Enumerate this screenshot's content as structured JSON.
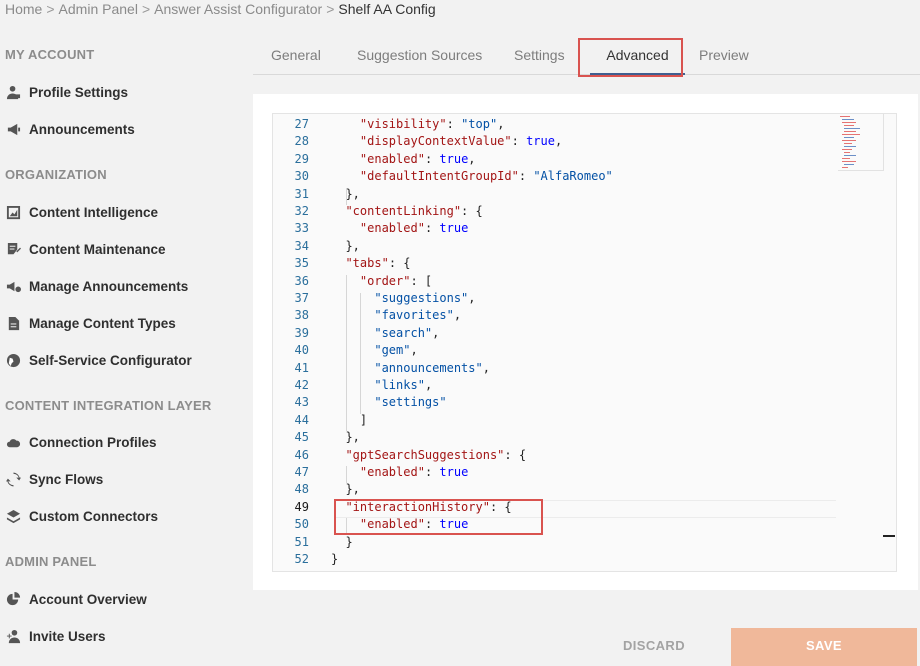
{
  "breadcrumb": {
    "items": [
      "Home",
      "Admin Panel",
      "Answer Assist Configurator"
    ],
    "current": "Shelf AA Config",
    "separator": ">"
  },
  "sidebar": {
    "my_account": {
      "title": "MY ACCOUNT",
      "items": [
        {
          "label": "Profile Settings",
          "icon": "profile-settings-icon"
        },
        {
          "label": "Announcements",
          "icon": "megaphone-icon"
        }
      ]
    },
    "organization": {
      "title": "ORGANIZATION",
      "items": [
        {
          "label": "Content Intelligence",
          "icon": "image-chart-icon"
        },
        {
          "label": "Content Maintenance",
          "icon": "document-edit-icon"
        },
        {
          "label": "Manage Announcements",
          "icon": "megaphone-gear-icon"
        },
        {
          "label": "Manage Content Types",
          "icon": "file-icon"
        },
        {
          "label": "Self-Service Configurator",
          "icon": "globe-icon"
        }
      ]
    },
    "integration": {
      "title": "CONTENT INTEGRATION LAYER",
      "items": [
        {
          "label": "Connection Profiles",
          "icon": "cloud-icon"
        },
        {
          "label": "Sync Flows",
          "icon": "sync-icon"
        },
        {
          "label": "Custom Connectors",
          "icon": "layers-icon"
        }
      ]
    },
    "admin_panel": {
      "title": "ADMIN PANEL",
      "items": [
        {
          "label": "Account Overview",
          "icon": "pie-chart-icon"
        },
        {
          "label": "Invite Users",
          "icon": "add-user-icon"
        }
      ]
    }
  },
  "tabs": [
    "General",
    "Suggestion Sources",
    "Settings",
    "Advanced",
    "Preview"
  ],
  "active_tab": "Advanced",
  "editor": {
    "lines": [
      {
        "n": "27",
        "t": [
          [
            "    ",
            "p"
          ],
          [
            "\"visibility\"",
            "k"
          ],
          [
            ": ",
            "p"
          ],
          [
            "\"top\"",
            "s"
          ],
          [
            ",",
            "p"
          ]
        ]
      },
      {
        "n": "28",
        "t": [
          [
            "    ",
            "p"
          ],
          [
            "\"displayContextValue\"",
            "k"
          ],
          [
            ": ",
            "p"
          ],
          [
            "true",
            "b"
          ],
          [
            ",",
            "p"
          ]
        ]
      },
      {
        "n": "29",
        "t": [
          [
            "    ",
            "p"
          ],
          [
            "\"enabled\"",
            "k"
          ],
          [
            ": ",
            "p"
          ],
          [
            "true",
            "b"
          ],
          [
            ",",
            "p"
          ]
        ]
      },
      {
        "n": "30",
        "t": [
          [
            "    ",
            "p"
          ],
          [
            "\"defaultIntentGroupId\"",
            "k"
          ],
          [
            ": ",
            "p"
          ],
          [
            "\"AlfaRomeo\"",
            "s"
          ]
        ]
      },
      {
        "n": "31",
        "t": [
          [
            "  },",
            "p"
          ]
        ]
      },
      {
        "n": "32",
        "t": [
          [
            "  ",
            "p"
          ],
          [
            "\"contentLinking\"",
            "k"
          ],
          [
            ": {",
            "p"
          ]
        ]
      },
      {
        "n": "33",
        "t": [
          [
            "    ",
            "p"
          ],
          [
            "\"enabled\"",
            "k"
          ],
          [
            ": ",
            "p"
          ],
          [
            "true",
            "b"
          ]
        ]
      },
      {
        "n": "34",
        "t": [
          [
            "  },",
            "p"
          ]
        ]
      },
      {
        "n": "35",
        "t": [
          [
            "  ",
            "p"
          ],
          [
            "\"tabs\"",
            "k"
          ],
          [
            ": {",
            "p"
          ]
        ]
      },
      {
        "n": "36",
        "t": [
          [
            "    ",
            "p"
          ],
          [
            "\"order\"",
            "k"
          ],
          [
            ": [",
            "p"
          ]
        ]
      },
      {
        "n": "37",
        "t": [
          [
            "      ",
            "p"
          ],
          [
            "\"suggestions\"",
            "s"
          ],
          [
            ",",
            "p"
          ]
        ]
      },
      {
        "n": "38",
        "t": [
          [
            "      ",
            "p"
          ],
          [
            "\"favorites\"",
            "s"
          ],
          [
            ",",
            "p"
          ]
        ]
      },
      {
        "n": "39",
        "t": [
          [
            "      ",
            "p"
          ],
          [
            "\"search\"",
            "s"
          ],
          [
            ",",
            "p"
          ]
        ]
      },
      {
        "n": "40",
        "t": [
          [
            "      ",
            "p"
          ],
          [
            "\"gem\"",
            "s"
          ],
          [
            ",",
            "p"
          ]
        ]
      },
      {
        "n": "41",
        "t": [
          [
            "      ",
            "p"
          ],
          [
            "\"announcements\"",
            "s"
          ],
          [
            ",",
            "p"
          ]
        ]
      },
      {
        "n": "42",
        "t": [
          [
            "      ",
            "p"
          ],
          [
            "\"links\"",
            "s"
          ],
          [
            ",",
            "p"
          ]
        ]
      },
      {
        "n": "43",
        "t": [
          [
            "      ",
            "p"
          ],
          [
            "\"settings\"",
            "s"
          ]
        ]
      },
      {
        "n": "44",
        "t": [
          [
            "    ]",
            "p"
          ]
        ]
      },
      {
        "n": "45",
        "t": [
          [
            "  },",
            "p"
          ]
        ]
      },
      {
        "n": "46",
        "t": [
          [
            "  ",
            "p"
          ],
          [
            "\"gptSearchSuggestions\"",
            "k"
          ],
          [
            ": {",
            "p"
          ]
        ]
      },
      {
        "n": "47",
        "t": [
          [
            "    ",
            "p"
          ],
          [
            "\"enabled\"",
            "k"
          ],
          [
            ": ",
            "p"
          ],
          [
            "true",
            "b"
          ]
        ]
      },
      {
        "n": "48",
        "t": [
          [
            "  },",
            "p"
          ]
        ]
      },
      {
        "n": "49",
        "t": [
          [
            "  ",
            "p"
          ],
          [
            "\"interactionHistory\"",
            "k"
          ],
          [
            ": {",
            "p"
          ]
        ]
      },
      {
        "n": "50",
        "t": [
          [
            "    ",
            "p"
          ],
          [
            "\"enabled\"",
            "k"
          ],
          [
            ": ",
            "p"
          ],
          [
            "true",
            "b"
          ]
        ]
      },
      {
        "n": "51",
        "t": [
          [
            "  }",
            "p"
          ]
        ]
      },
      {
        "n": "52",
        "t": [
          [
            "}",
            "p"
          ]
        ]
      }
    ],
    "current_line": "49"
  },
  "actions": {
    "discard_label": "DISCARD",
    "save_label": "SAVE"
  },
  "colors": {
    "accent": "#3f5e8f",
    "save_bg": "#f0b89a",
    "highlight": "#d9534f"
  }
}
